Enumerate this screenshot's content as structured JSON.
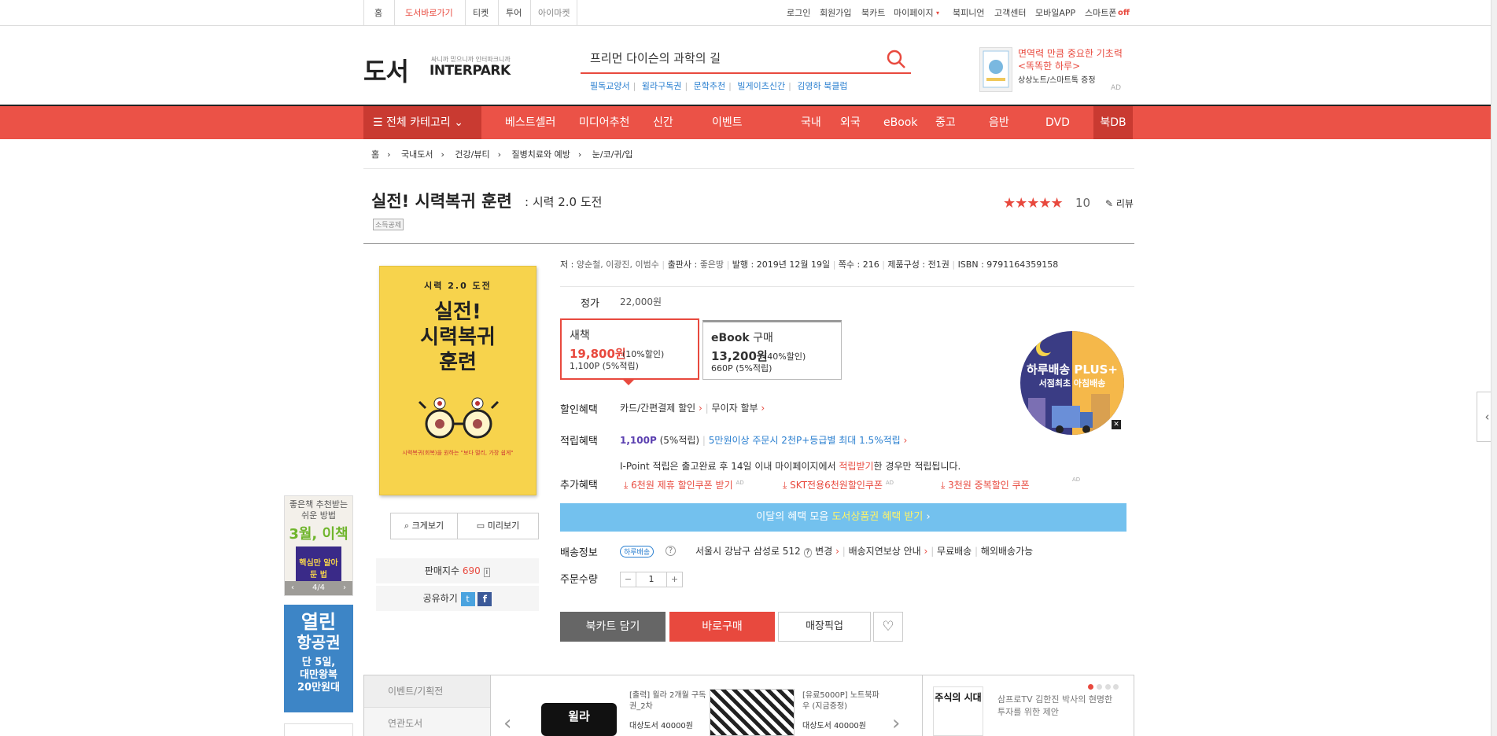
{
  "util": {
    "left": [
      "홈",
      "도서바로가기",
      "티켓",
      "투어",
      "아이마켓"
    ],
    "right": [
      "로그인",
      "회원가입",
      "북카트",
      "마이페이지",
      "북피니언",
      "고객센터",
      "모바일APP",
      "스마트폰"
    ],
    "smartphone_state": "off"
  },
  "header": {
    "logo": "도서",
    "logo_sub": "싸니까 믿으니까 인터파크니까",
    "logo_brand": "INTERPARK",
    "search_value": "프리먼 다이슨의 과학의 길",
    "keywords": [
      "필독교양서",
      "윌라구독권",
      "문학추천",
      "빌게이츠신간",
      "김영하 북클럽"
    ],
    "ad_line1": "면역력 만큼 중요한 기초력",
    "ad_line2": "<똑똑한 하루>",
    "ad_line3": "상상노트/스마트톡 증정",
    "ad_tag": "AD"
  },
  "nav": {
    "all_label": "전체 카테고리",
    "items": [
      "베스트셀러",
      "미디어추천",
      "신간",
      "이벤트"
    ],
    "sub_items": [
      "국내",
      "외국",
      "eBook",
      "중고",
      "음반",
      "DVD"
    ],
    "bookdb": "북DB"
  },
  "breadcrumb": [
    "홈",
    "국내도서",
    "건강/뷰티",
    "질병치료와 예방",
    "눈/코/귀/입"
  ],
  "book": {
    "title": "실전! 시력복귀 훈련",
    "subtitle": ": 시력 2.0 도전",
    "badge": "소득공제",
    "stars": "★★★★★",
    "rating": "10",
    "review_label": "리뷰",
    "cover_top": "시력 2.0 도전",
    "cover_title_1": "실전!",
    "cover_title_2": "시력복귀",
    "cover_title_3": "훈련",
    "cover_caption": "시력복귀(회복)을 원하는 \"보다 멀리, 가장 쉽게\"",
    "zoom_label": "크게보기",
    "preview_label": "미리보기",
    "sales_label": "판매지수",
    "sales_value": "690",
    "share_label": "공유하기"
  },
  "meta": {
    "author_label": "저",
    "author": "양순철, 이광진, 이범수",
    "publisher_label": "출판사",
    "publisher": "좋은땅",
    "date_label": "발행",
    "date": "2019년 12월 19일",
    "pages_label": "쪽수",
    "pages": "216",
    "composition_label": "제품구성",
    "composition": "전1권",
    "isbn_label": "ISBN",
    "isbn": "9791164359158"
  },
  "price": {
    "list_label": "정가",
    "list_price": "22,000원",
    "new_title": "새책",
    "new_price": "19,800원",
    "new_discount": "(10%할인)",
    "new_points": "1,100P (5%적립)",
    "ebook_title": "eBook",
    "ebook_buy": "구매",
    "ebook_price": "13,200원",
    "ebook_discount": "(40%할인)",
    "ebook_points": "660P (5%적립)"
  },
  "benefits": {
    "discount_label": "할인혜택",
    "discount_items": [
      "카드/간편결제 할인",
      "무이자 할부"
    ],
    "points_label": "적립혜택",
    "points_value": "1,100P",
    "points_rate": "(5%적립)",
    "points_extra": "5만원이상 주문시 2천P+등급별 최대 1.5%적립",
    "ipoint_text_1": "I-Point 적립은 출고완료 후 14일 이내 마이페이지에서",
    "ipoint_link": "적립받기",
    "ipoint_text_2": "한 경우만 적립됩니다.",
    "extra_label": "추가혜택",
    "coupons": [
      "6천원 제휴 할인쿠폰 받기",
      "SKT전용6천원할인쿠폰",
      "3천원 중복할인 쿠폰"
    ],
    "coupon_tag": "AD",
    "promo_text": "이달의 혜택 모음",
    "promo_link": "도서상품권 혜택 받기",
    "shipping_label": "배송정보",
    "shipping_tag": "하루배송",
    "shipping_address": "서울시 강남구 삼성로 512",
    "shipping_change": "변경",
    "shipping_items": [
      "배송지연보상 안내",
      "무료배송",
      "해외배송가능"
    ],
    "qty_label": "주문수량",
    "qty_value": "1"
  },
  "actions": {
    "cart": "북카트 담기",
    "buy": "바로구매",
    "pickup": "매장픽업"
  },
  "bubble": {
    "line1": "하루배송 PLUS+",
    "line2": "서점최초 아침배송"
  },
  "side": {
    "ad1_line1": "좋은책 추천받는",
    "ad1_line2": "쉬운 방법",
    "ad1_month": "3월, 이책",
    "ad1_book": "핵심만 알아둔 법",
    "ad1_page": "4/4",
    "ad2_line1": "열린",
    "ad2_line2": "항공권",
    "ad2_line3": "단 5일,",
    "ad2_line4": "대만왕복",
    "ad2_line5": "20만원대"
  },
  "bottom": {
    "tab1": "이벤트/기획전",
    "tab2": "연관도서",
    "card1_title": "[출력] 윌라 2개월 구독권_2차",
    "card1_sub": "대상도서 40000원",
    "card1_logo": "윌라",
    "card2_title": "[유료5000P] 노트북파우 (지금증정)",
    "card2_sub": "대상도서 40000원",
    "card3_book": "주식의 시대",
    "card3_text": "삼프로TV 김한진 박사의 현명한 투자를 위한 제안"
  },
  "colors": {
    "accent": "#eb5247",
    "nav_dark": "#c93a31",
    "link_blue": "#2a7fd0",
    "promo_blue": "#73c1ee",
    "cover_yellow": "#f7d34c"
  }
}
